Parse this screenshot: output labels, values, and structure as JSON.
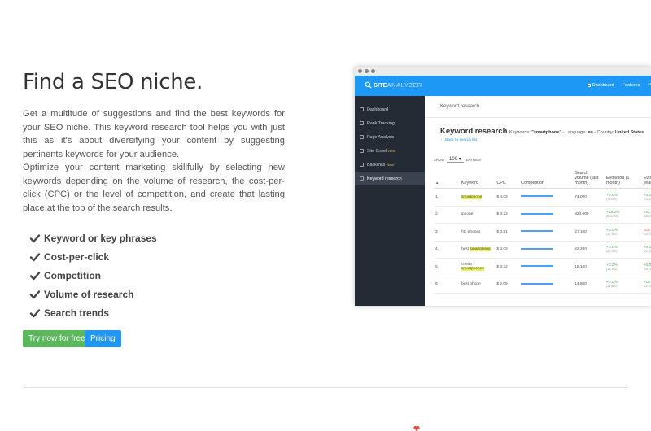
{
  "hero": {
    "title": "Find a SEO niche.",
    "paragraph1": "Get a multitude of suggestions and find the best keywords for your SEO niche. This keyword research tool helps you with just this as it's about diversifying your content by suggesting pertinents keywords for your audience.",
    "paragraph2": "Optimize your content marketing skillfully by selecting new keywords depending on the volume of research, the cost-per-click (CPC) or the level of competition, and create that lasting place at the top of the search results."
  },
  "features": [
    "Keyword or key phrases",
    "Cost-per-click",
    "Competition",
    "Volume of research",
    "Search trends"
  ],
  "buttons": {
    "try_label": "Try now for free!",
    "pricing_label": "Pricing"
  },
  "colors": {
    "brand_blue": "#1e98f5",
    "success_green": "#5cb85c",
    "sidebar_dark": "#252b35",
    "highlight_yellow": "#e6f05a"
  },
  "app": {
    "brand_a": "SITE",
    "brand_b": "ANALYZER",
    "nav": [
      "Dashboard",
      "Features",
      "P"
    ],
    "sidebar": [
      {
        "label": "Dashboard",
        "badge": "",
        "active": false
      },
      {
        "label": "Rank Tracking",
        "badge": "",
        "active": false
      },
      {
        "label": "Page Analysis",
        "badge": "",
        "active": false
      },
      {
        "label": "Site Crawl",
        "badge": "New!",
        "active": false
      },
      {
        "label": "Backlinks",
        "badge": "New!",
        "active": false
      },
      {
        "label": "Keyword research",
        "badge": "",
        "active": true
      }
    ],
    "breadcrumb": "Keyword research",
    "page_title": "Keyword research",
    "meta_keywords_label": "Keywords:",
    "meta_keywords_value": "\"smartphone\"",
    "meta_language_label": "- Language:",
    "meta_language_value": "en",
    "meta_country_label": "- Country:",
    "meta_country_value": "United States",
    "back_link": "← Back to search list",
    "show_label": "SHOW",
    "show_value": "100",
    "entries_label": "ENTRIES",
    "columns": [
      "▲",
      "Keyword",
      "CPC",
      "Competition",
      "Search volume (last month)",
      "Evolution (1 month)",
      "Evolu (1 year"
    ],
    "rows": [
      {
        "rank": "1",
        "keyword": "smartphone",
        "highlight": [
          "smartphone"
        ],
        "cpc": "$ 4.03",
        "competition": 1.0,
        "volume": "74,000",
        "evo_month": "+0.0%",
        "evo_month_sub": "(74,000)",
        "evo_month_sign": "pos",
        "evo_year": "+0.0%",
        "evo_year_sub": "(74,000)",
        "evo_year_sign": "pos"
      },
      {
        "rank": "2",
        "keyword": "iphone",
        "highlight": [],
        "cpc": "$ 3.23",
        "competition": 1.0,
        "volume": "823,000",
        "evo_month": "+18.2%",
        "evo_month_sub": "(673,000)",
        "evo_month_sign": "pos",
        "evo_year": "+22.2%",
        "evo_year_sub": "(550,000)",
        "evo_year_sign": "pos"
      },
      {
        "rank": "3",
        "keyword": "htc phones",
        "highlight": [],
        "cpc": "$ 0.91",
        "competition": 1.0,
        "volume": "27,100",
        "evo_month": "+0.0%",
        "evo_month_sub": "(27,100)",
        "evo_month_sign": "pos",
        "evo_year": "-22.1%",
        "evo_year_sub": "(33,100)",
        "evo_year_sign": "neg"
      },
      {
        "rank": "4",
        "keyword": "best smartphone",
        "highlight": [
          "smartphone"
        ],
        "cpc": "$ 3.03",
        "competition": 1.0,
        "volume": "22,200",
        "evo_month": "+0.0%",
        "evo_month_sub": "(22,200)",
        "evo_month_sign": "pos",
        "evo_year": "+0.0%",
        "evo_year_sub": "(22,200)",
        "evo_year_sign": "pos"
      },
      {
        "rank": "5",
        "keyword": "cheap smartphones",
        "highlight": [
          "smartphones"
        ],
        "cpc": "$ 3.32",
        "competition": 1.0,
        "volume": "18,100",
        "evo_month": "+0.0%",
        "evo_month_sub": "(18,100)",
        "evo_month_sign": "pos",
        "evo_year": "+0.0%",
        "evo_year_sub": "(18,100)",
        "evo_year_sign": "pos"
      },
      {
        "rank": "6",
        "keyword": "best phone",
        "highlight": [],
        "cpc": "$ 2.09",
        "competition": 1.0,
        "volume": "14,800",
        "evo_month": "+0.0%",
        "evo_month_sub": "(14,800)",
        "evo_month_sign": "pos",
        "evo_year": "+18.2%",
        "evo_year_sub": "(12,100)",
        "evo_year_sign": "pos"
      }
    ]
  }
}
